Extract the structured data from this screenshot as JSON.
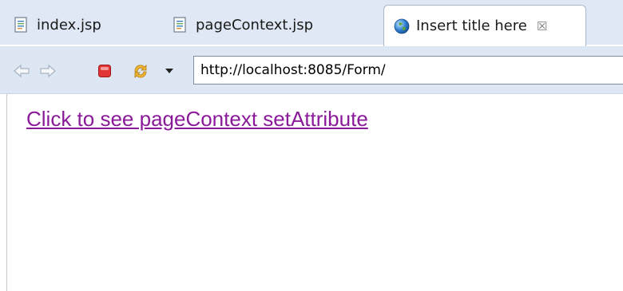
{
  "tabs": [
    {
      "label": "index.jsp",
      "icon": "jsp-file-icon",
      "active": false
    },
    {
      "label": "pageContext.jsp",
      "icon": "jsp-file-icon",
      "active": false
    },
    {
      "label": "Insert title here",
      "icon": "globe-icon",
      "active": true,
      "close_glyph": "☒"
    }
  ],
  "toolbar": {
    "url": "http://localhost:8085/Form/"
  },
  "page": {
    "link_text": "Click to see pageContext setAttribute",
    "link_color": "#8a1a9a"
  }
}
